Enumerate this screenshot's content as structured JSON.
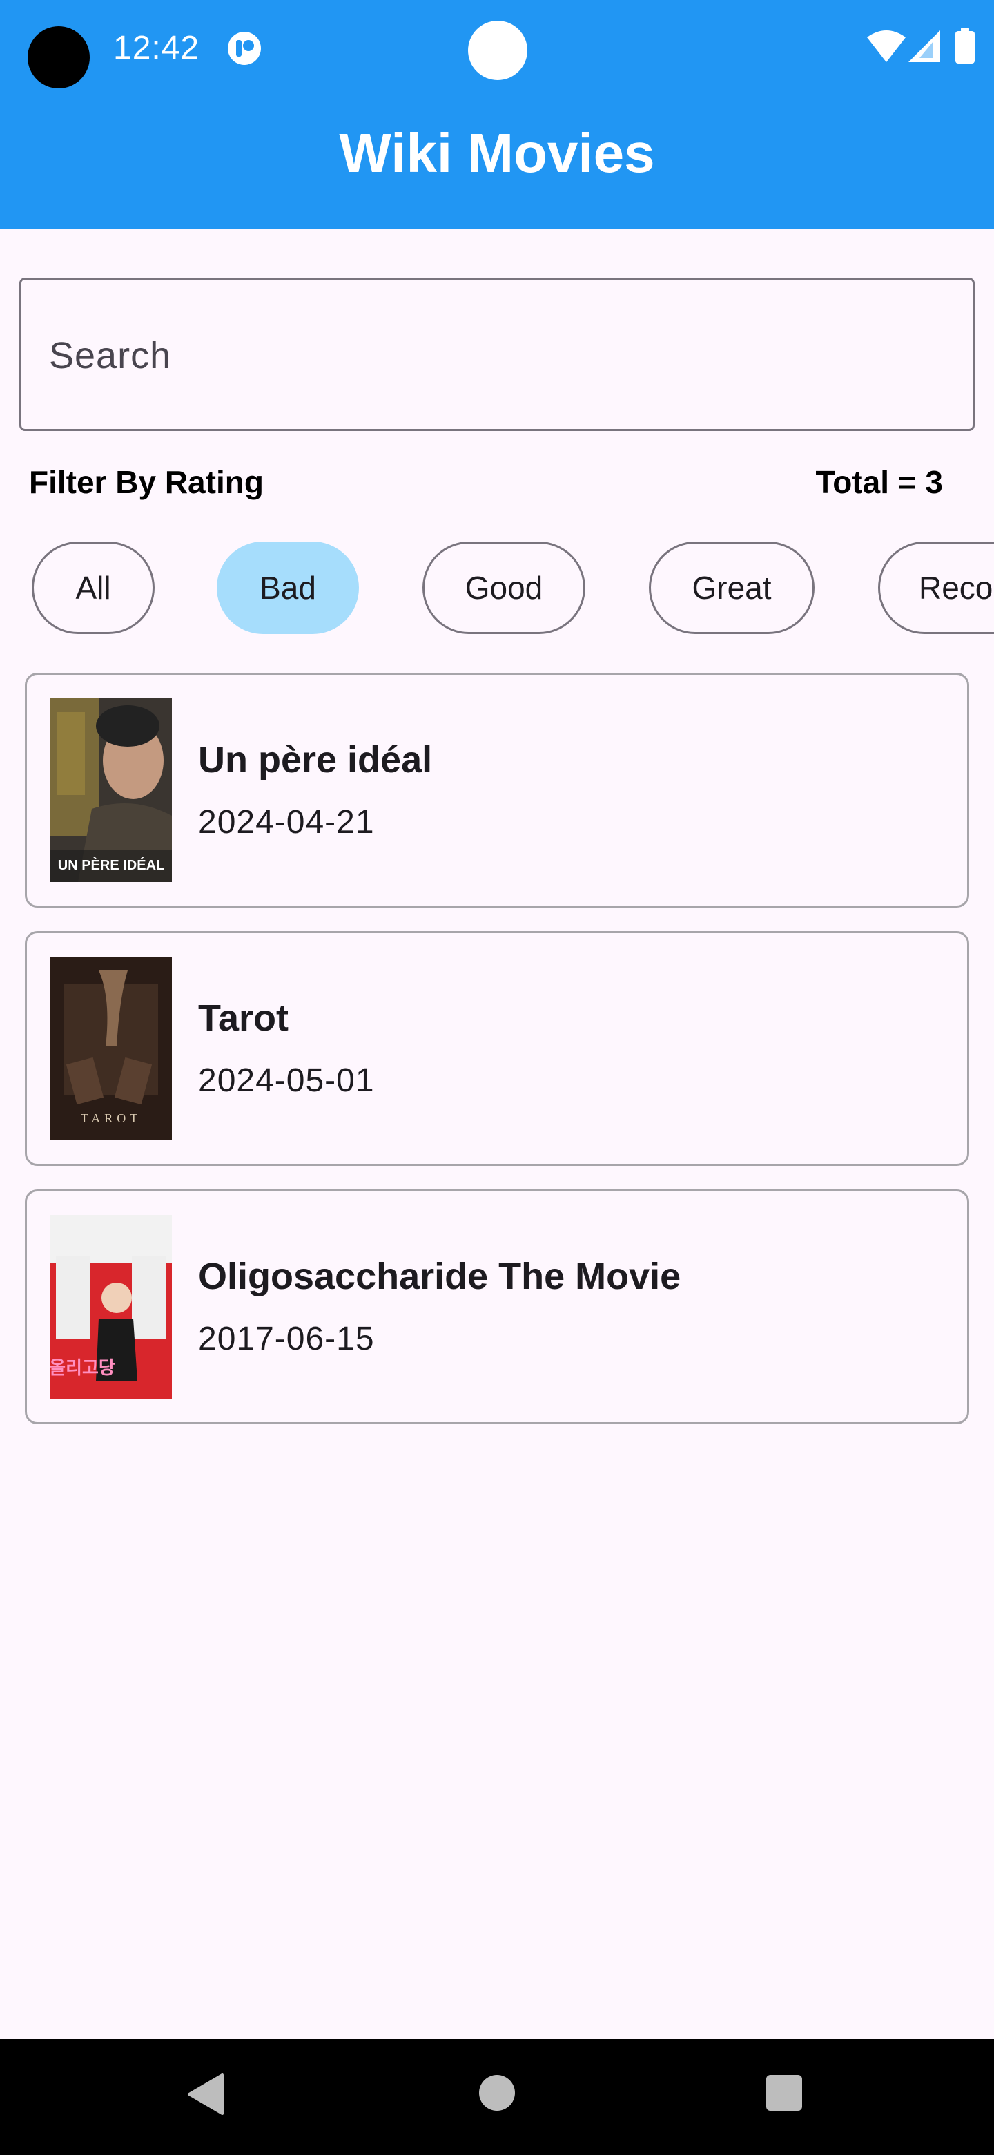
{
  "status_bar": {
    "time": "12:42"
  },
  "app_bar": {
    "title": "Wiki Movies",
    "color": "#2196F3"
  },
  "search": {
    "placeholder": "Search",
    "value": ""
  },
  "filter": {
    "label": "Filter By Rating",
    "total": "Total = 3",
    "chips": [
      {
        "label": "All",
        "selected": false
      },
      {
        "label": "Bad",
        "selected": true
      },
      {
        "label": "Good",
        "selected": false
      },
      {
        "label": "Great",
        "selected": false
      },
      {
        "label": "Reco",
        "selected": false
      }
    ],
    "selected_color": "#A6DDFC"
  },
  "movies": [
    {
      "title": "Un père idéal",
      "date": "2024-04-21",
      "poster_text": "UN PÈRE IDÉAL"
    },
    {
      "title": "Tarot",
      "date": "2024-05-01",
      "poster_text": "TAROT"
    },
    {
      "title": "Oligosaccharide The Movie",
      "date": "2017-06-15",
      "poster_text": "올리고당"
    }
  ],
  "icons": {
    "notification": "app-notification-icon",
    "wifi": "wifi-icon",
    "signal": "signal-icon",
    "battery": "battery-icon",
    "back": "back-icon",
    "home": "home-icon",
    "recents": "recents-icon"
  }
}
